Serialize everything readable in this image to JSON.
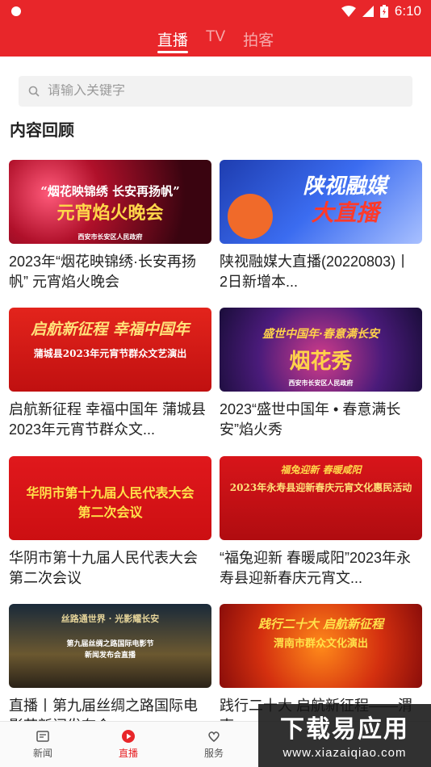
{
  "status": {
    "time": "6:10"
  },
  "tabs": [
    {
      "label": "直播",
      "active": true
    },
    {
      "label": "TV",
      "active": false
    },
    {
      "label": "拍客",
      "active": false
    }
  ],
  "search": {
    "placeholder": "请输入关键字"
  },
  "section_title": "内容回顾",
  "cards": [
    {
      "title": "2023年“烟花映锦绣·长安再扬帆” 元宵焰火晚会",
      "thumb_text": [
        "“烟花映锦绣 长安再扬帆”",
        "元宵焰火晚会",
        "西安市长安区人民政府"
      ]
    },
    {
      "title": "陕视融媒大直播(20220803)丨 2日新增本...",
      "thumb_text": [
        "陕视融媒",
        "大直播"
      ]
    },
    {
      "title": "启航新征程 幸福中国年 蒲城县2023年元宵节群众文...",
      "thumb_text": [
        "启航新征程 幸福中国年",
        "蒲城县2023年元宵节群众文艺演出"
      ]
    },
    {
      "title": "2023“盛世中国年 • 春意满长安”焰火秀",
      "thumb_text": [
        "盛世中国年·春意满长安",
        "烟花秀",
        "西安市长安区人民政府"
      ]
    },
    {
      "title": "华阴市第十九届人民代表大会第二次会议",
      "thumb_text": [
        "华阴市第十九届人民代表大会",
        "第二次会议"
      ]
    },
    {
      "title": "“福兔迎新 春暖咸阳”2023年永寿县迎新春庆元宵文...",
      "thumb_text": [
        "福兔迎新 春暖咸阳",
        "2023年永寿县迎新春庆元宵文化惠民活动"
      ]
    },
    {
      "title": "直播丨第九届丝绸之路国际电影节新闻发布会",
      "thumb_text": [
        "丝路通世界 · 光影耀长安",
        "第九届丝绸之路国际电影节",
        "新闻发布会直播"
      ]
    },
    {
      "title": "践行二十大 启航新征程——渭南...",
      "thumb_text": [
        "践行二十大 启航新征程",
        "渭南市群众文化演出"
      ]
    }
  ],
  "bottom_nav": [
    {
      "label": "新闻",
      "icon": "news-icon",
      "active": false
    },
    {
      "label": "直播",
      "icon": "live-play-icon",
      "active": true
    },
    {
      "label": "服务",
      "icon": "service-heart-icon",
      "active": false
    },
    {
      "label": "",
      "icon": "",
      "active": false
    },
    {
      "label": "",
      "icon": "",
      "active": false
    }
  ],
  "watermark": {
    "main": "下载易应用",
    "sub": "www.xiazaiqiao.com"
  },
  "colors": {
    "brand_red": "#e8262a"
  }
}
